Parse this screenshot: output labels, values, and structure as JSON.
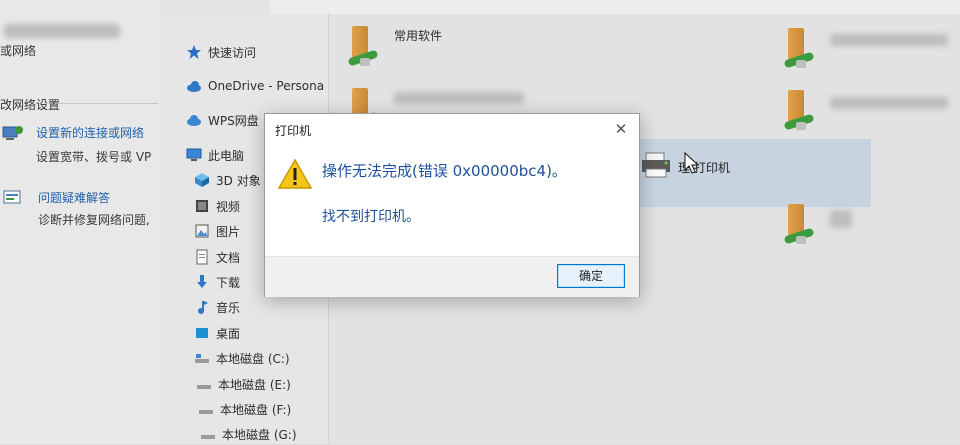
{
  "network_panel": {
    "heading_partial": "或网络",
    "section_title": "改网络设置",
    "setup_link": "设置新的连接或网络",
    "setup_desc": "设置宽带、拨号或 VP",
    "troubleshoot_link": "问题疑难解答",
    "troubleshoot_desc": "诊断并修复网络问题,"
  },
  "nav": {
    "items": [
      {
        "label": "快速访问",
        "icon": "star-icon"
      },
      {
        "label": "OneDrive - Persona",
        "icon": "cloud-icon"
      },
      {
        "label": "WPS网盘",
        "icon": "cloud-icon"
      },
      {
        "label": "此电脑",
        "icon": "computer-icon"
      },
      {
        "label": "3D 对象",
        "icon": "cube-icon"
      },
      {
        "label": "视频",
        "icon": "video-icon"
      },
      {
        "label": "图片",
        "icon": "picture-icon"
      },
      {
        "label": "文档",
        "icon": "document-icon"
      },
      {
        "label": "下载",
        "icon": "download-icon"
      },
      {
        "label": "音乐",
        "icon": "music-icon"
      },
      {
        "label": "桌面",
        "icon": "desktop-icon"
      },
      {
        "label": "本地磁盘 (C:)",
        "icon": "drive-icon"
      },
      {
        "label": "本地磁盘 (E:)",
        "icon": "drive-icon"
      },
      {
        "label": "本地磁盘 (F:)",
        "icon": "drive-icon"
      },
      {
        "label": "本地磁盘 (G:)",
        "icon": "drive-icon"
      }
    ]
  },
  "content": {
    "shared_folder_label": "常用软件",
    "printer_label": "理 打印机"
  },
  "dialog": {
    "title": "打印机",
    "close_glyph": "✕",
    "message": "操作无法完成(错误 0x00000bc4)。",
    "detail": "找不到打印机。",
    "ok_label": "确定"
  },
  "colors": {
    "link_blue": "#1f5fa8",
    "message_blue": "#1e4f9a",
    "selection": "#c7d4e0",
    "ok_border": "#0078d7"
  }
}
